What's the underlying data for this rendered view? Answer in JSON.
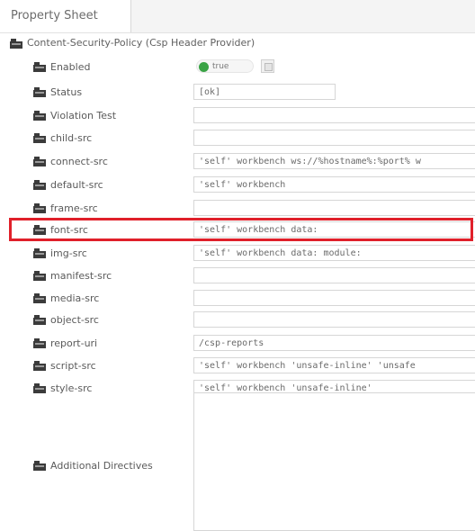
{
  "tab": {
    "label": "Property Sheet"
  },
  "section": {
    "label": "Content-Security-Policy  (Csp Header Provider)"
  },
  "rows": [
    {
      "label": "Enabled",
      "value": "true"
    },
    {
      "label": "Status",
      "value": "[ok]"
    },
    {
      "label": "Violation Test",
      "value": ""
    },
    {
      "label": "child-src",
      "value": ""
    },
    {
      "label": "connect-src",
      "value": "'self' workbench ws://%hostname%:%port% w"
    },
    {
      "label": "default-src",
      "value": "'self' workbench"
    },
    {
      "label": "frame-src",
      "value": ""
    },
    {
      "label": "font-src",
      "value": "'self' workbench data:"
    },
    {
      "label": "img-src",
      "value": "'self' workbench data: module:"
    },
    {
      "label": "manifest-src",
      "value": ""
    },
    {
      "label": "media-src",
      "value": ""
    },
    {
      "label": "object-src",
      "value": ""
    },
    {
      "label": "report-uri",
      "value": "/csp-reports"
    },
    {
      "label": "script-src",
      "value": "'self' workbench 'unsafe-inline' 'unsafe"
    },
    {
      "label": "style-src",
      "value": "'self' workbench 'unsafe-inline'"
    }
  ],
  "additional": {
    "label": "Additional Directives",
    "value": ""
  },
  "colors": {
    "highlight": "#e0202a",
    "toggle_on": "#3aa345"
  },
  "icons": {
    "section": "property-folder-icon",
    "row": "property-slot-icon"
  }
}
